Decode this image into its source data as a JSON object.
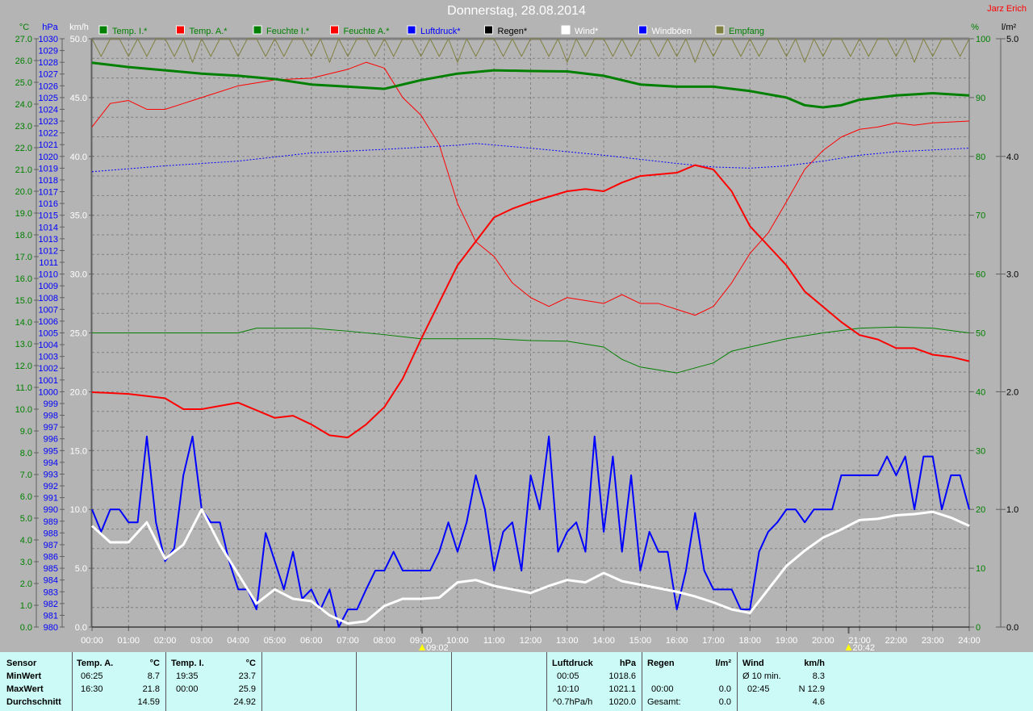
{
  "header": {
    "title": "Donnerstag, 28.08.2014",
    "owner": "Jarz Erich"
  },
  "legend": [
    {
      "label": "Temp. I.*",
      "color": "#008000",
      "text_color": "#008000"
    },
    {
      "label": "Temp. A.*",
      "color": "#ff0000",
      "text_color": "#008000"
    },
    {
      "label": "Feuchte I.*",
      "color": "#008000",
      "text_color": "#008000"
    },
    {
      "label": "Feuchte A.*",
      "color": "#ff0000",
      "text_color": "#008000"
    },
    {
      "label": "Luftdruck*",
      "color": "#0000ff",
      "text_color": "#0000ff"
    },
    {
      "label": "Regen*",
      "color": "#000000",
      "text_color": "#000000"
    },
    {
      "label": "Wind*",
      "color": "#ffffff",
      "text_color": "#ffffff"
    },
    {
      "label": "Windböen",
      "color": "#0000ff",
      "text_color": "#ffffff"
    },
    {
      "label": "Empfang",
      "color": "#808040",
      "text_color": "#008000"
    }
  ],
  "chart_data": {
    "type": "line",
    "x_unit": "hours",
    "x_ticks": [
      "00:00",
      "01:00",
      "02:00",
      "03:00",
      "04:00",
      "05:00",
      "06:00",
      "07:00",
      "08:00",
      "09:00",
      "10:00",
      "11:00",
      "12:00",
      "13:00",
      "14:00",
      "15:00",
      "16:00",
      "17:00",
      "18:00",
      "19:00",
      "20:00",
      "21:00",
      "22:00",
      "23:00",
      "24:00"
    ],
    "axes": {
      "temp": {
        "unit": "°C",
        "range": [
          0,
          27
        ],
        "step": 1,
        "color": "#008000"
      },
      "pressure": {
        "unit": "hPa",
        "range": [
          980,
          1030
        ],
        "step": 1,
        "color": "#0000ff"
      },
      "wind": {
        "unit": "km/h",
        "range": [
          0,
          50
        ],
        "step": 5,
        "color": "#ffffff"
      },
      "humidity": {
        "unit": "%",
        "range": [
          0,
          100
        ],
        "step": 10,
        "color": "#008000"
      },
      "rain": {
        "unit": "l/m²",
        "range": [
          0,
          5
        ],
        "step": 1,
        "color": "#000000"
      }
    },
    "markers": [
      {
        "time": 9.033,
        "label": "09:02",
        "kind": "sunrise"
      },
      {
        "time": 20.7,
        "label": "20:42",
        "kind": "sunset"
      }
    ],
    "series": [
      {
        "name": "Feuchte I.",
        "axis": "humidity",
        "color": "#008000",
        "width": 1,
        "x": [
          0,
          4,
          4.5,
          6,
          7,
          8,
          9,
          11,
          12,
          13,
          14,
          14.5,
          15,
          16,
          17,
          17.5,
          18,
          19,
          20,
          21,
          22,
          23,
          24
        ],
        "y": [
          50,
          50,
          50.8,
          50.8,
          50.3,
          49.7,
          49,
          49,
          48.7,
          48.6,
          47.6,
          45.5,
          44.2,
          43.2,
          44.9,
          46.9,
          47.6,
          49,
          50,
          50.8,
          51,
          50.8,
          50
        ]
      },
      {
        "name": "Feuchte A.",
        "axis": "humidity",
        "color": "#ff0000",
        "width": 1,
        "x": [
          0,
          0.5,
          1,
          1.5,
          2,
          2.5,
          3,
          4,
          5,
          6,
          7,
          7.5,
          8,
          8.5,
          9,
          9.5,
          10,
          10.5,
          11,
          11.5,
          12,
          12.5,
          13,
          14,
          14.5,
          15,
          15.5,
          16,
          16.5,
          17,
          17.5,
          18,
          18.5,
          19,
          19.5,
          20,
          20.5,
          21,
          21.5,
          22,
          22.5,
          23,
          24
        ],
        "y": [
          85,
          89,
          89.5,
          88,
          88,
          89,
          90,
          92,
          93,
          93.3,
          94.8,
          96,
          95,
          90,
          87,
          82,
          72,
          65.5,
          63,
          58.5,
          56,
          54.5,
          56,
          55,
          56.5,
          55,
          55,
          54,
          53,
          54.5,
          58.5,
          63.5,
          67,
          72.3,
          77.8,
          81,
          83.3,
          84.6,
          85,
          85.7,
          85.3,
          85.7,
          86
        ]
      },
      {
        "name": "Luftdruck",
        "axis": "pressure",
        "color": "#0000ff",
        "width": 1,
        "dash": "2,2",
        "x": [
          0,
          2,
          4,
          6,
          8,
          10,
          10.5,
          12,
          14,
          16,
          17,
          18,
          19,
          20,
          21,
          22,
          24
        ],
        "y": [
          1018.7,
          1019.2,
          1019.6,
          1020.3,
          1020.6,
          1020.95,
          1021.1,
          1020.7,
          1020.1,
          1019.4,
          1019.1,
          1019.0,
          1019.2,
          1019.6,
          1020.1,
          1020.4,
          1020.7
        ]
      },
      {
        "name": "Temp. I.",
        "axis": "temp",
        "color": "#008000",
        "width": 3,
        "x": [
          0,
          1,
          2,
          3,
          4,
          5,
          6,
          7,
          8,
          9,
          10,
          11,
          12,
          13,
          14,
          15,
          16,
          17,
          18,
          19,
          19.5,
          20,
          20.5,
          21,
          22,
          23,
          24
        ],
        "y": [
          25.9,
          25.7,
          25.55,
          25.4,
          25.3,
          25.15,
          24.9,
          24.8,
          24.7,
          25.1,
          25.4,
          25.55,
          25.52,
          25.5,
          25.3,
          24.9,
          24.8,
          24.8,
          24.6,
          24.3,
          23.95,
          23.85,
          23.95,
          24.2,
          24.4,
          24.5,
          24.4
        ]
      },
      {
        "name": "Temp. A.",
        "axis": "temp",
        "color": "#ff0000",
        "width": 2,
        "x": [
          0,
          1,
          1.5,
          2,
          2.5,
          3,
          4,
          5,
          5.5,
          6,
          6.5,
          7,
          7.5,
          8,
          8.5,
          9,
          9.5,
          10,
          10.5,
          11,
          11.5,
          12,
          13,
          13.5,
          14,
          14.5,
          15,
          16,
          16.5,
          17,
          17.5,
          18,
          18.5,
          19,
          19.5,
          20,
          20.5,
          21,
          21.5,
          22,
          22.5,
          23,
          23.5,
          24
        ],
        "y": [
          10.78,
          10.7,
          10.6,
          10.5,
          10.0,
          10.0,
          10.3,
          9.6,
          9.7,
          9.3,
          8.8,
          8.7,
          9.3,
          10.1,
          11.4,
          13.2,
          14.9,
          16.6,
          17.7,
          18.8,
          19.2,
          19.5,
          20.0,
          20.1,
          20.0,
          20.4,
          20.7,
          20.85,
          21.2,
          21.0,
          20.0,
          18.4,
          17.5,
          16.6,
          15.4,
          14.7,
          14.0,
          13.4,
          13.2,
          12.8,
          12.8,
          12.5,
          12.4,
          12.2
        ]
      },
      {
        "name": "Regen",
        "axis": "rain",
        "color": "#000000",
        "width": 1,
        "x": [
          0,
          24
        ],
        "y": [
          0,
          0
        ]
      },
      {
        "name": "Windböen",
        "axis": "wind",
        "color": "#0000ff",
        "width": 2,
        "step_minutes": 15,
        "y": [
          10,
          8.1,
          10,
          10,
          8.9,
          8.9,
          16.2,
          8.9,
          5.6,
          6.7,
          12.9,
          16.2,
          10,
          8.9,
          8.9,
          5.6,
          3.2,
          3.2,
          1.5,
          8,
          5.6,
          3.2,
          6.4,
          2.4,
          3.2,
          1.5,
          3.2,
          0,
          1.5,
          1.5,
          3.2,
          4.8,
          4.8,
          6.4,
          4.8,
          4.8,
          4.8,
          4.8,
          6.4,
          8.9,
          6.4,
          8.9,
          12.9,
          10,
          4.8,
          8.1,
          8.9,
          4.8,
          12.9,
          10,
          16.2,
          6.4,
          8.1,
          8.9,
          6.4,
          16.2,
          8.1,
          14.5,
          6.4,
          12.9,
          4.8,
          8.1,
          6.4,
          6.4,
          1.5,
          4.8,
          9.7,
          4.8,
          3.2,
          3.2,
          3.2,
          1.5,
          1.5,
          6.4,
          8.1,
          8.9,
          10,
          10,
          8.9,
          10,
          10,
          10,
          12.9,
          12.9,
          12.9,
          12.9,
          12.9,
          14.5,
          12.9,
          14.5,
          10,
          14.5,
          14.5,
          10,
          12.9,
          12.9,
          10
        ]
      },
      {
        "name": "Wind",
        "axis": "wind",
        "color": "#ffffff",
        "width": 3,
        "step_minutes": 30,
        "y": [
          8.6,
          7.2,
          7.2,
          8.9,
          5.8,
          7,
          10,
          7,
          4.5,
          2,
          3.2,
          2.4,
          2.2,
          1,
          0.3,
          0.5,
          1.8,
          2.4,
          2.4,
          2.5,
          3.8,
          4,
          3.5,
          3.2,
          2.9,
          3.5,
          4,
          3.8,
          4.6,
          3.9,
          3.6,
          3.3,
          3,
          2.6,
          2.1,
          1.5,
          1.2,
          3.2,
          5.2,
          6.5,
          7.6,
          8.3,
          9.1,
          9.2,
          9.5,
          9.6,
          9.8,
          9.3,
          8.6
        ]
      },
      {
        "name": "Empfang",
        "axis": "humidity",
        "color": "#808040",
        "width": 1,
        "step_minutes": 15,
        "y": [
          100,
          97,
          100,
          100,
          97,
          100,
          97,
          100,
          100,
          97,
          100,
          96,
          100,
          97,
          100,
          100,
          97,
          100,
          100,
          97,
          100,
          97,
          100,
          100,
          97,
          100,
          96,
          100,
          97,
          100,
          100,
          97,
          100,
          97,
          100,
          100,
          97,
          100,
          97,
          100,
          96,
          100,
          97,
          100,
          100,
          97,
          100,
          97,
          100,
          100,
          97,
          100,
          96,
          100,
          97,
          100,
          100,
          97,
          100,
          97,
          100,
          100,
          97,
          100,
          97,
          100,
          96,
          100,
          97,
          100,
          100,
          97,
          100,
          97,
          100,
          100,
          97,
          100,
          96,
          100,
          97,
          100,
          100,
          97,
          100,
          97,
          100,
          100,
          97,
          100,
          96,
          100,
          97,
          100,
          100,
          97,
          100
        ]
      }
    ]
  },
  "stats": {
    "sensor": {
      "h": "Sensor",
      "min": "MinWert",
      "max": "MaxWert",
      "avg": "Durchschnitt"
    },
    "temp_a": {
      "h": "Temp. A.",
      "u": "°C",
      "min_t": "06:25",
      "min_v": "8.7",
      "max_t": "16:30",
      "max_v": "21.8",
      "avg": "14.59"
    },
    "temp_i": {
      "h": "Temp. I.",
      "u": "°C",
      "min_t": "19:35",
      "min_v": "23.7",
      "max_t": "00:00",
      "max_v": "25.9",
      "avg": "24.92"
    },
    "pressure": {
      "h": "Luftdruck",
      "u": "hPa",
      "min_t": "00:05",
      "min_v": "1018.6",
      "max_t": "10:10",
      "max_v": "1021.1",
      "trend_t": "^0.7hPa/h",
      "trend_v": "1020.0"
    },
    "rain": {
      "h": "Regen",
      "u": "l/m²",
      "max_t": "00:00",
      "max_v": "0.0",
      "total_l": "Gesamt:",
      "total_v": "0.0"
    },
    "wind": {
      "h": "Wind",
      "u": "km/h",
      "avg_l": "Ø 10 min.",
      "avg_v": "8.3",
      "max_t": "02:45",
      "max_v": "N 12.9",
      "mean_v": "4.6"
    }
  }
}
